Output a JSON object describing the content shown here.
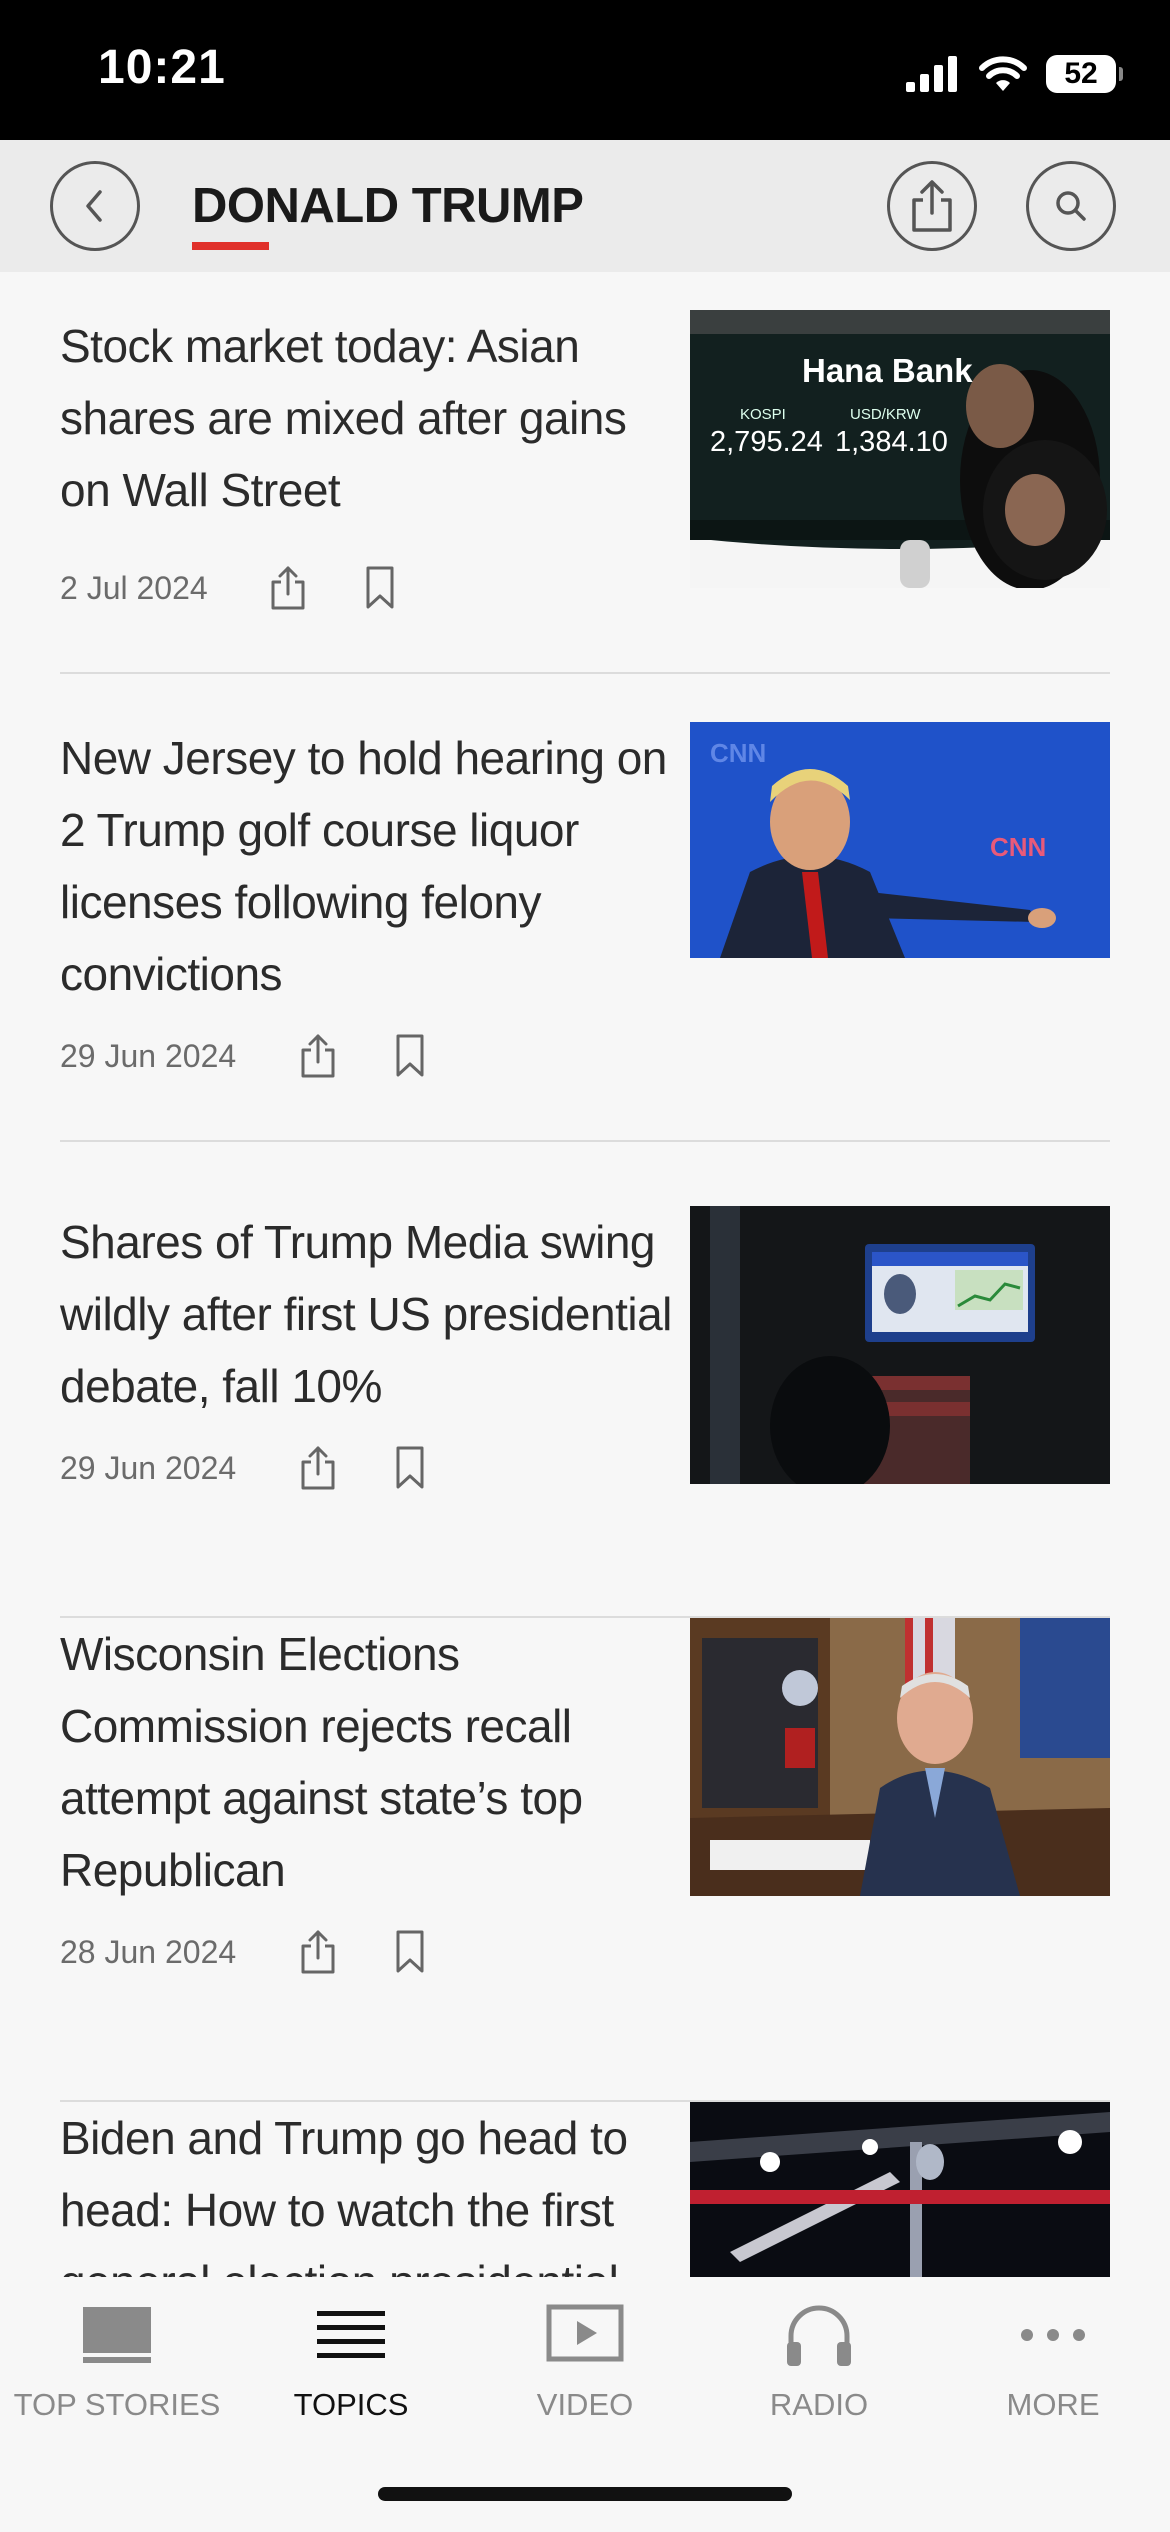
{
  "status_bar": {
    "time": "10:21",
    "battery": "52"
  },
  "header": {
    "title": "DONALD TRUMP",
    "accent_color": "#e0302a"
  },
  "articles": [
    {
      "title": "Stock market today: Asian shares are mixed after gains on Wall Street",
      "date": "2 Jul 2024",
      "image": {
        "brand": "Hana Bank",
        "left_label": "KOSPI",
        "left_value": "2,795.24",
        "right_label": "USD/KRW",
        "right_value": "1,384.10"
      }
    },
    {
      "title": "New Jersey to hold hearing on 2 Trump golf course liquor licenses following felony convictions",
      "date": "29 Jun 2024",
      "image": {
        "backdrop_text": "CNN"
      }
    },
    {
      "title": "Shares of Trump Media swing wildly after first US presidential debate, fall 10%",
      "date": "29 Jun 2024",
      "image": {}
    },
    {
      "title": "Wisconsin Elections Commission rejects recall attempt against state’s top Republican",
      "date": "28 Jun 2024",
      "image": {}
    },
    {
      "title": "Biden and Trump go head to head: How to watch the first general election presidential",
      "image": {}
    }
  ],
  "tabs": [
    {
      "label": "TOP STORIES",
      "icon": "top-stories-icon",
      "active": false
    },
    {
      "label": "TOPICS",
      "icon": "topics-list-icon",
      "active": true
    },
    {
      "label": "VIDEO",
      "icon": "video-play-icon",
      "active": false
    },
    {
      "label": "RADIO",
      "icon": "headphones-icon",
      "active": false
    },
    {
      "label": "MORE",
      "icon": "more-dots-icon",
      "active": false
    }
  ]
}
